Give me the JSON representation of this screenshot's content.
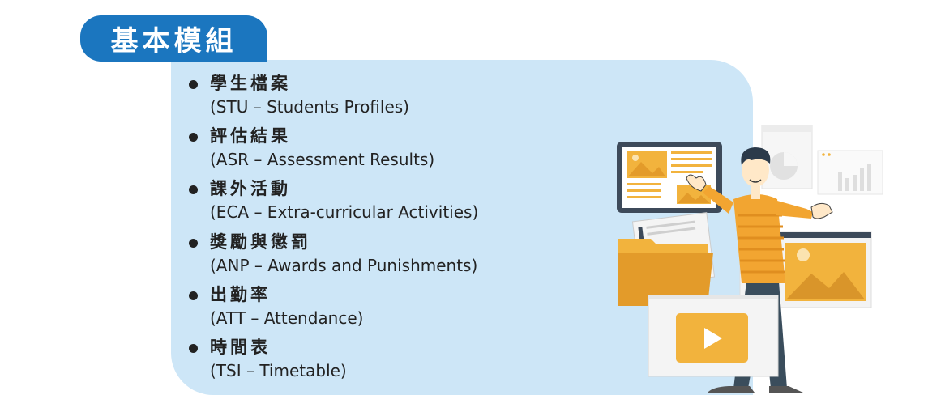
{
  "title": "基本模組",
  "modules": [
    {
      "zh": "學生檔案",
      "en": "(STU – Students Profiles)"
    },
    {
      "zh": "評估結果",
      "en": "(ASR – Assessment Results)"
    },
    {
      "zh": "課外活動",
      "en": "(ECA – Extra-curricular Activities)"
    },
    {
      "zh": "獎勵與懲罰",
      "en": "(ANP – Awards and Punishments)"
    },
    {
      "zh": "出勤率",
      "en": "(ATT – Attendance)"
    },
    {
      "zh": "時間表",
      "en": "(TSI – Timetable)"
    }
  ],
  "colors": {
    "title_tab": "#1b76bf",
    "panel": "#cde6f7",
    "accent_orange": "#f2b33d",
    "text": "#222222"
  },
  "illustration": {
    "subject": "presenter-with-media-panels-icon"
  }
}
